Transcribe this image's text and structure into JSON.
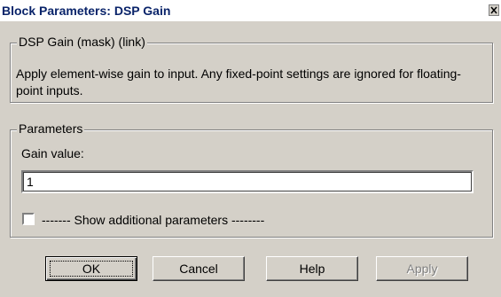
{
  "window": {
    "title": "Block Parameters: DSP Gain"
  },
  "mask_group": {
    "legend": "DSP Gain (mask) (link)",
    "description": "Apply element-wise gain to input. Any fixed-point settings are ignored for floating-point inputs."
  },
  "params_group": {
    "legend": "Parameters",
    "gain_label": "Gain value:",
    "gain_value": "1",
    "checkbox_label": "------- Show additional parameters --------",
    "checkbox_checked": false
  },
  "buttons": {
    "ok": "OK",
    "cancel": "Cancel",
    "help": "Help",
    "apply": "Apply"
  },
  "icons": {
    "close": "close-icon"
  }
}
